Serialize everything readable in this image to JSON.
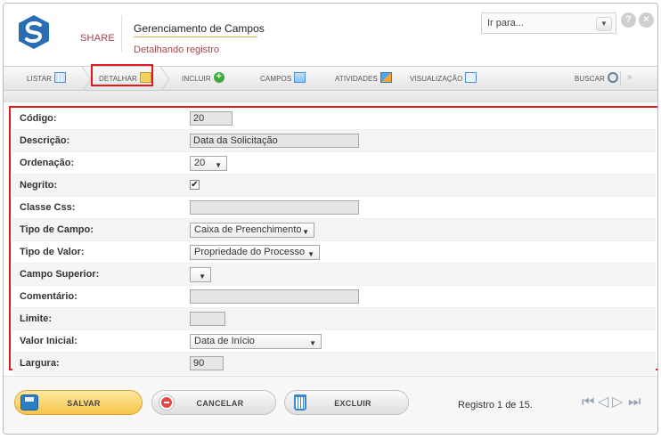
{
  "header": {
    "brand": "SHARE",
    "title": "Gerenciamento de Campos",
    "subtitle": "Detalhando registro",
    "goto_text": "Ir para...",
    "help_symbol": "?",
    "close_symbol": "×"
  },
  "toolbar": {
    "items": [
      {
        "label": "LISTAR",
        "icon": "list-icon"
      },
      {
        "label": "DETALHAR",
        "icon": "detail-icon"
      },
      {
        "label": "INCLUIR",
        "icon": "add-icon"
      },
      {
        "label": "CAMPOS",
        "icon": "fields-icon"
      },
      {
        "label": "ATIVIDADES",
        "icon": "activities-icon"
      },
      {
        "label": "VISUALIZAÇÃO",
        "icon": "view-icon"
      }
    ],
    "search_label": "BUSCAR",
    "add_symbol": "+",
    "chevron": "»"
  },
  "form": {
    "rows": [
      {
        "label": "Código:",
        "value": "20"
      },
      {
        "label": "Descrição:",
        "value": "Data da Solicitação"
      },
      {
        "label": "Ordenação:",
        "value": "20"
      },
      {
        "label": "Negrito:",
        "value": "✔"
      },
      {
        "label": "Classe Css:",
        "value": ""
      },
      {
        "label": "Tipo de Campo:",
        "value": "Caixa de Preenchimento"
      },
      {
        "label": "Tipo de Valor:",
        "value": "Propriedade do Processo"
      },
      {
        "label": "Campo Superior:",
        "value": ""
      },
      {
        "label": "Comentário:",
        "value": ""
      },
      {
        "label": "Limite:",
        "value": ""
      },
      {
        "label": "Valor Inicial:",
        "value": "Data de Início"
      },
      {
        "label": "Largura:",
        "value": "90"
      }
    ],
    "select_arrow": "▼"
  },
  "footer": {
    "save_label": "SALVAR",
    "cancel_label": "CANCELAR",
    "delete_label": "EXCLUIR",
    "record_text": "Registro 1 de 15.",
    "nav_first": "⏮",
    "nav_prev": "◁",
    "nav_next": "▷",
    "nav_last": "⏭"
  },
  "colors": {
    "brand": "#a0434a",
    "highlight": "#e0191f",
    "save_button": "#f6c44a"
  }
}
